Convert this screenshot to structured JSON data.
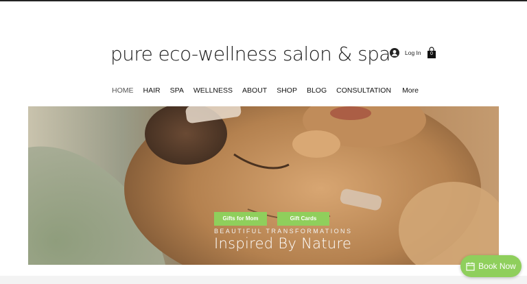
{
  "brand": {
    "logo_text": "pure eco-wellness salon & spa"
  },
  "header": {
    "login_label": "Log In",
    "cart_count": "0",
    "icons": {
      "login": "user-avatar-icon",
      "cart": "shopping-bag-icon"
    }
  },
  "nav": {
    "items": [
      {
        "label": "HOME",
        "active": true
      },
      {
        "label": "HAIR"
      },
      {
        "label": "SPA"
      },
      {
        "label": "WELLNESS"
      },
      {
        "label": "ABOUT"
      },
      {
        "label": "SHOP"
      },
      {
        "label": "BLOG"
      },
      {
        "label": "CONSULTATION"
      }
    ],
    "more_label": "More"
  },
  "hero": {
    "button_gifts_mom": "Gifts for Mom",
    "button_gift_cards": "Gift Cards",
    "tagline": "BEAUTIFUL TRANSFORMATIONS",
    "heading": "Inspired By Nature"
  },
  "book_now": {
    "label": "Book Now",
    "icon": "calendar-icon"
  },
  "colors": {
    "accent_green": "#8fcf5c",
    "text_dark": "#111111",
    "hero_skin": "#a27e55"
  }
}
